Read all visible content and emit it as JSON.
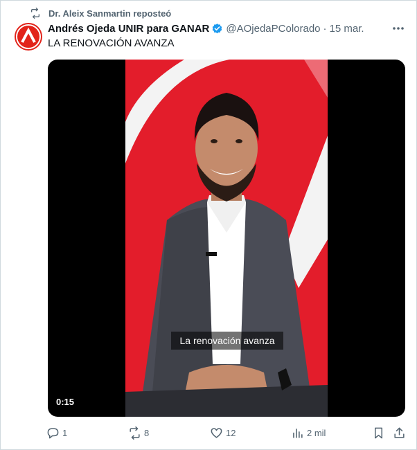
{
  "repost": {
    "label": "Dr. Aleix Sanmartin reposteó",
    "icon": "repost-icon"
  },
  "author": {
    "display_name": "Andrés Ojeda UNIR para GANAR",
    "handle": "@AOjedaPColorado",
    "separator": "·",
    "date": "15 mar.",
    "verified": true,
    "avatar_color": "#e2231a"
  },
  "post": {
    "text": "LA RENOVACIÓN AVANZA"
  },
  "video": {
    "duration": "0:15",
    "caption": "La renovación avanza",
    "background_color": "#e31d2b"
  },
  "actions": {
    "replies": "1",
    "reposts": "8",
    "likes": "12",
    "views": "2 mil"
  },
  "colors": {
    "text": "#0f1419",
    "secondary": "#536471",
    "verified": "#1d9bf0",
    "brand_red": "#e2231a"
  }
}
